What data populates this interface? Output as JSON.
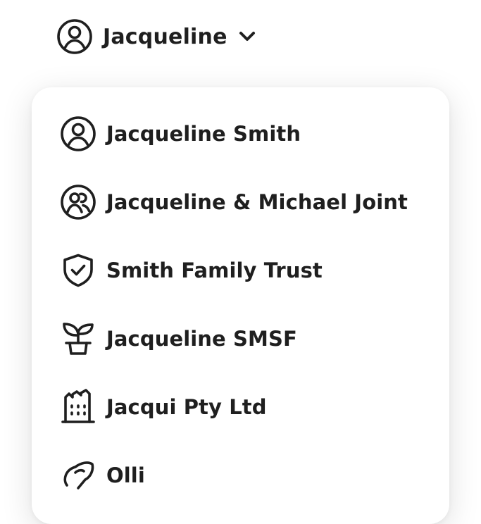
{
  "account_switcher": {
    "current_label": "Jacqueline",
    "icon": "user-circle-icon",
    "chevron_icon": "chevron-down-icon"
  },
  "menu": {
    "items": [
      {
        "label": "Jacqueline Smith",
        "icon": "user-circle-icon"
      },
      {
        "label": "Jacqueline & Michael Joint",
        "icon": "users-circle-icon"
      },
      {
        "label": "Smith Family Trust",
        "icon": "shield-check-icon"
      },
      {
        "label": "Jacqueline SMSF",
        "icon": "plant-pot-icon"
      },
      {
        "label": "Jacqui Pty Ltd",
        "icon": "building-icon"
      },
      {
        "label": "Olli",
        "icon": "piggy-bank-icon"
      }
    ]
  },
  "colors": {
    "text": "#1f1f1f",
    "background": "#ffffff"
  }
}
